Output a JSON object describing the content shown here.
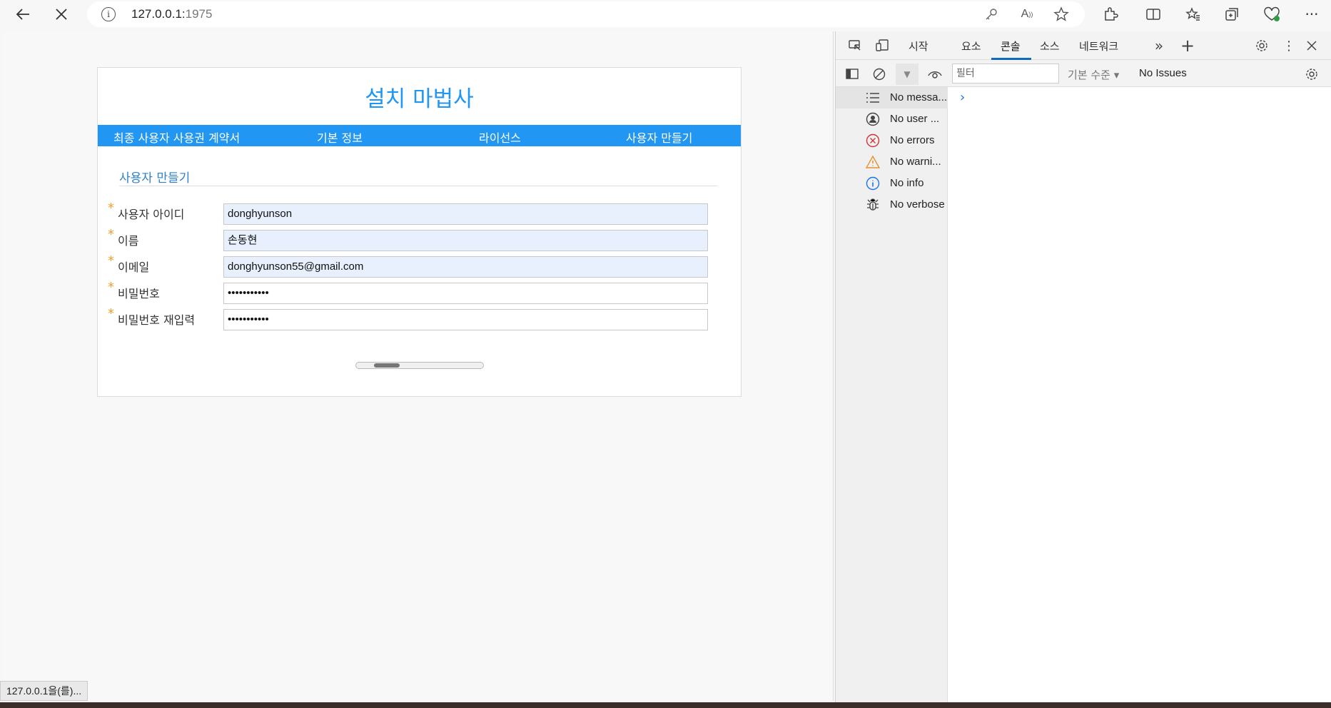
{
  "browser": {
    "url_host": "127.0.0.1:",
    "url_port": "1975",
    "status_text": "127.0.0.1을(를)..."
  },
  "wizard": {
    "title": "설치 마법사",
    "steps": [
      "최종 사용자 사용권 계약서",
      "기본 정보",
      "라이선스",
      "사용자 만들기"
    ],
    "section_title": "사용자 만들기",
    "fields": [
      {
        "label": "사용자 아이디",
        "value": "donghyunson",
        "required": "*"
      },
      {
        "label": "이름",
        "value": "손동현",
        "required": "*"
      },
      {
        "label": "이메일",
        "value": "donghyunson55@gmail.com",
        "required": "*"
      },
      {
        "label": "비밀번호",
        "value": "•••••••••••",
        "required": "*"
      },
      {
        "label": "비밀번호 재입력",
        "value": "•••••••••••",
        "required": "*"
      }
    ]
  },
  "devtools": {
    "tabs": [
      "시작",
      "요소",
      "콘솔",
      "소스",
      "네트워크"
    ],
    "active_tab": "콘솔",
    "filter_placeholder": "필터",
    "level": "기본 수준 ▾",
    "issues": "No Issues",
    "sidebar": [
      {
        "icon": "list-icon",
        "label": "No messa..."
      },
      {
        "icon": "user-icon",
        "label": "No user ..."
      },
      {
        "icon": "error-icon",
        "label": "No errors"
      },
      {
        "icon": "warning-icon",
        "label": "No warni..."
      },
      {
        "icon": "info-icon",
        "label": "No info"
      },
      {
        "icon": "bug-icon",
        "label": "No verbose"
      }
    ]
  },
  "colors": {
    "accent": "#2196f3",
    "required": "#f0a030",
    "autofill": "#e8f0fe"
  }
}
